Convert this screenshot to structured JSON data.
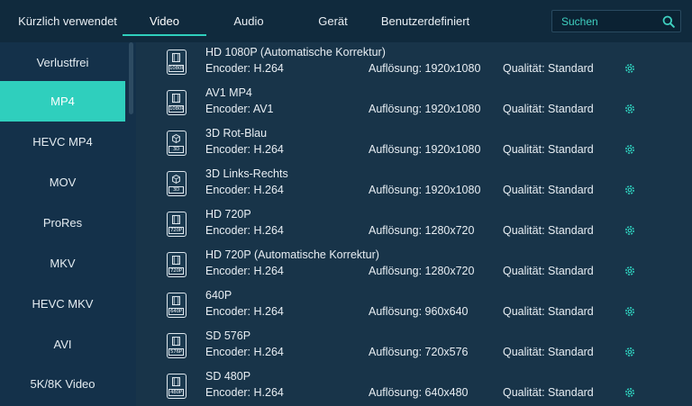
{
  "tabs": [
    {
      "label": "Kürzlich verwendet"
    },
    {
      "label": "Video"
    },
    {
      "label": "Audio"
    },
    {
      "label": "Gerät"
    },
    {
      "label": "Benutzerdefiniert"
    }
  ],
  "search": {
    "placeholder": "Suchen"
  },
  "sidebar": {
    "items": [
      {
        "label": "Verlustfrei"
      },
      {
        "label": "MP4"
      },
      {
        "label": "HEVC MP4"
      },
      {
        "label": "MOV"
      },
      {
        "label": "ProRes"
      },
      {
        "label": "MKV"
      },
      {
        "label": "HEVC MKV"
      },
      {
        "label": "AVI"
      },
      {
        "label": "5K/8K Video"
      }
    ]
  },
  "formats": [
    {
      "title": "HD 1080P (Automatische Korrektur)",
      "encoder": "Encoder: H.264",
      "resolution": "Auflösung: 1920x1080",
      "quality": "Qualität: Standard",
      "icon": "film-icon",
      "tag": "1080P"
    },
    {
      "title": "AV1 MP4",
      "encoder": "Encoder: AV1",
      "resolution": "Auflösung: 1920x1080",
      "quality": "Qualität: Standard",
      "icon": "film-icon",
      "tag": "1080P"
    },
    {
      "title": "3D Rot-Blau",
      "encoder": "Encoder: H.264",
      "resolution": "Auflösung: 1920x1080",
      "quality": "Qualität: Standard",
      "icon": "cube-icon",
      "tag": "3D"
    },
    {
      "title": "3D Links-Rechts",
      "encoder": "Encoder: H.264",
      "resolution": "Auflösung: 1920x1080",
      "quality": "Qualität: Standard",
      "icon": "cube-icon",
      "tag": "3D"
    },
    {
      "title": "HD 720P",
      "encoder": "Encoder: H.264",
      "resolution": "Auflösung: 1280x720",
      "quality": "Qualität: Standard",
      "icon": "film-icon",
      "tag": "720P"
    },
    {
      "title": "HD 720P (Automatische Korrektur)",
      "encoder": "Encoder: H.264",
      "resolution": "Auflösung: 1280x720",
      "quality": "Qualität: Standard",
      "icon": "film-icon",
      "tag": "720P"
    },
    {
      "title": "640P",
      "encoder": "Encoder: H.264",
      "resolution": "Auflösung: 960x640",
      "quality": "Qualität: Standard",
      "icon": "film-icon",
      "tag": "640P"
    },
    {
      "title": "SD 576P",
      "encoder": "Encoder: H.264",
      "resolution": "Auflösung: 720x576",
      "quality": "Qualität: Standard",
      "icon": "film-icon",
      "tag": "576P"
    },
    {
      "title": "SD 480P",
      "encoder": "Encoder: H.264",
      "resolution": "Auflösung: 640x480",
      "quality": "Qualität: Standard",
      "icon": "film-icon",
      "tag": "480P"
    }
  ],
  "colors": {
    "accent": "#2fcfbd",
    "background": "#173247",
    "topbar": "#102a3d"
  }
}
